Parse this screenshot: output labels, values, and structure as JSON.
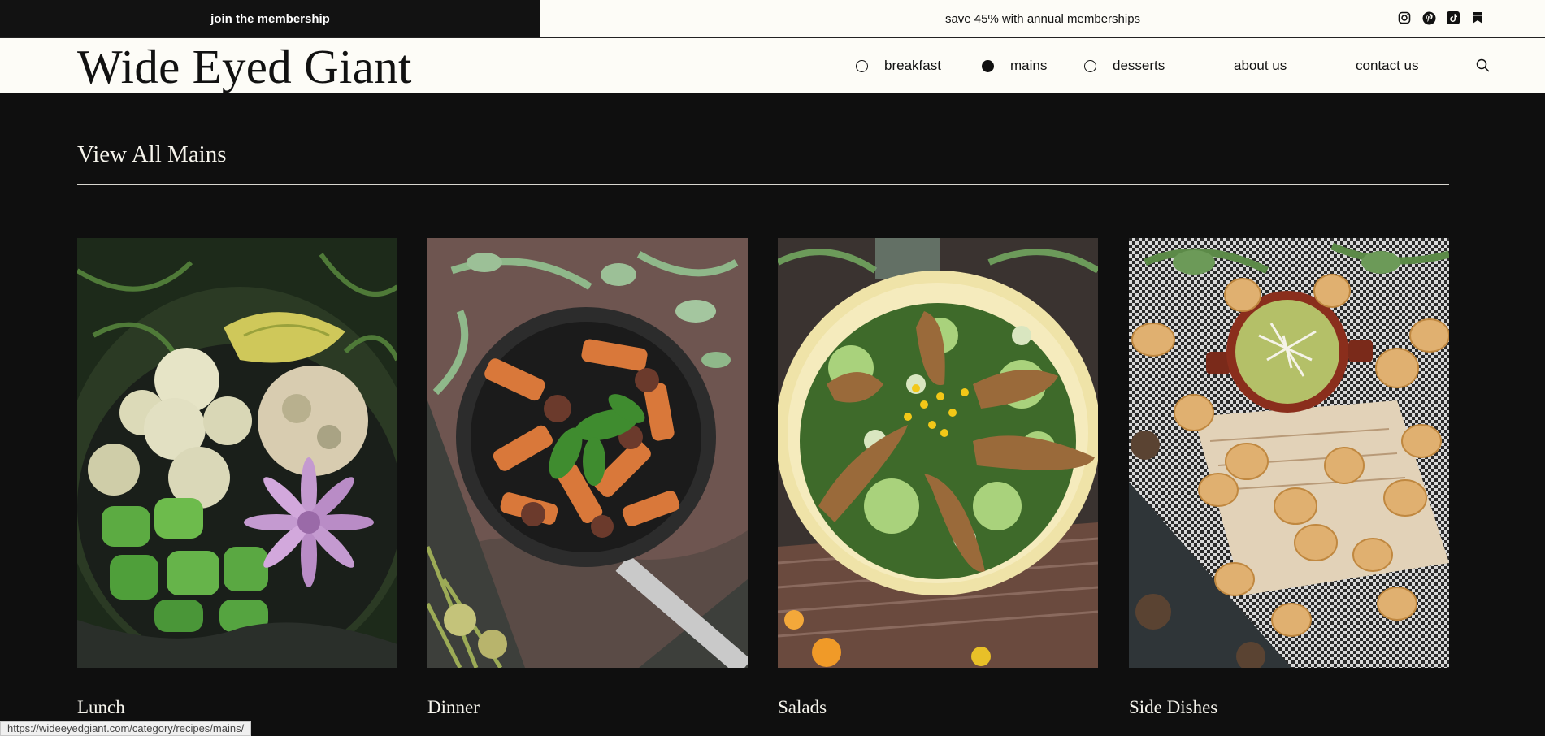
{
  "banner": {
    "join_label": "join the membership",
    "promo_text": "save 45% with annual memberships"
  },
  "social_icons": [
    "instagram-icon",
    "pinterest-icon",
    "tiktok-icon",
    "bookmark-icon"
  ],
  "brand": {
    "logo_text": "Wide Eyed Giant"
  },
  "nav": {
    "items": [
      {
        "label": "breakfast",
        "selected": false
      },
      {
        "label": "mains",
        "selected": true
      },
      {
        "label": "desserts",
        "selected": false
      },
      {
        "label": "about us"
      },
      {
        "label": "contact us"
      }
    ]
  },
  "main": {
    "heading": "View All Mains",
    "categories": [
      {
        "label": "Lunch"
      },
      {
        "label": "Dinner"
      },
      {
        "label": "Salads"
      },
      {
        "label": "Side Dishes"
      }
    ]
  },
  "status_url": "https://wideeyedgiant.com/category/recipes/mains/",
  "colors": {
    "page_bg": "#0f0f0f",
    "nav_bg": "#fdfcf7",
    "text_light": "#f6f4ec",
    "text_dark": "#111111"
  }
}
